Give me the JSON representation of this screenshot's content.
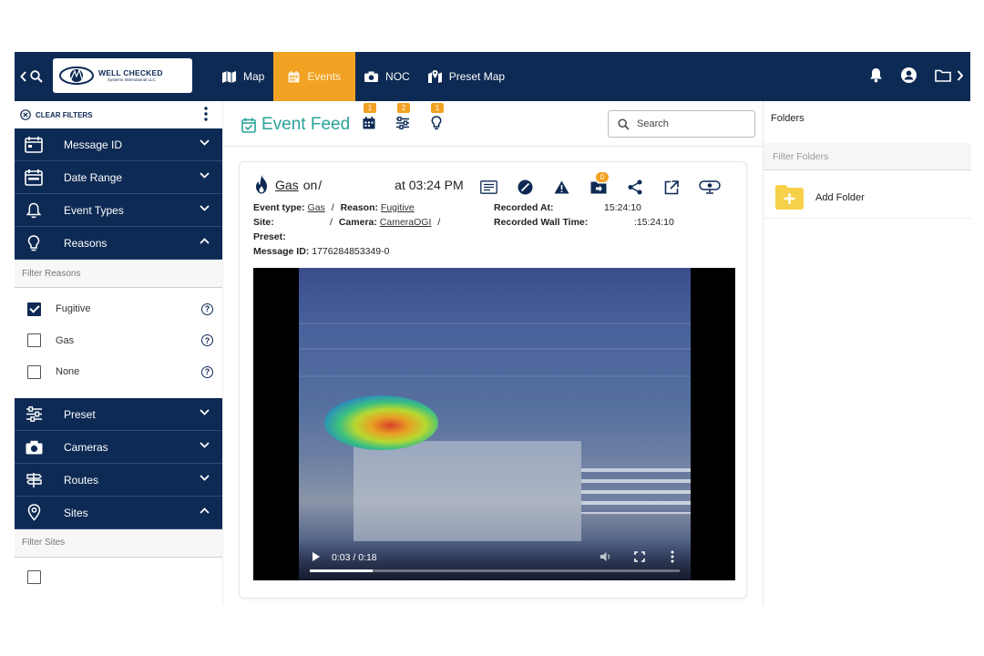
{
  "header": {
    "logo": {
      "title": "WELL CHECKED",
      "subtitle": "Systems International LLC"
    },
    "nav": [
      {
        "label": "Map",
        "icon": "map-icon"
      },
      {
        "label": "Events",
        "icon": "calendar-icon",
        "active": true
      },
      {
        "label": "NOC",
        "icon": "camera-icon"
      },
      {
        "label": "Preset Map",
        "icon": "map-pin-icon"
      }
    ],
    "right_icons": [
      "bell-icon",
      "account-icon",
      "folder-icon",
      "chevron-right-icon"
    ]
  },
  "sidebar": {
    "clear_filters": "CLEAR FILTERS",
    "sections": [
      {
        "label": "Message ID",
        "icon": "card-icon",
        "expanded": false
      },
      {
        "label": "Date Range",
        "icon": "calendar-icon",
        "expanded": false
      },
      {
        "label": "Event Types",
        "icon": "bell-icon",
        "expanded": false
      },
      {
        "label": "Reasons",
        "icon": "lightbulb-icon",
        "expanded": true
      },
      {
        "label": "Preset",
        "icon": "sliders-icon",
        "expanded": false
      },
      {
        "label": "Cameras",
        "icon": "camera-icon",
        "expanded": false
      },
      {
        "label": "Routes",
        "icon": "signpost-icon",
        "expanded": false
      },
      {
        "label": "Sites",
        "icon": "location-icon",
        "expanded": true
      }
    ],
    "reasons": {
      "filter_placeholder": "Filter Reasons",
      "items": [
        {
          "label": "Fugitive",
          "checked": true
        },
        {
          "label": "Gas",
          "checked": false
        },
        {
          "label": "None",
          "checked": false
        }
      ],
      "help_glyph": "?"
    },
    "sites": {
      "filter_placeholder": "Filter Sites"
    }
  },
  "feed": {
    "title": "Event Feed",
    "icons": [
      {
        "name": "calendar-icon",
        "badge": "1"
      },
      {
        "name": "sliders-icon",
        "badge": "2"
      },
      {
        "name": "lightbulb-icon",
        "badge": "1"
      }
    ],
    "search_placeholder": "Search"
  },
  "event": {
    "type_link": "Gas",
    "on_text": "on",
    "slash": "/",
    "time": "at 03:24 PM",
    "folder_badge": "0",
    "labels": {
      "event_type": "Event type:",
      "reason": "Reason:",
      "site": "Site:",
      "camera": "Camera:",
      "preset": "Preset:",
      "message_id": "Message ID:",
      "recorded_at": "Recorded At:",
      "recorded_wall_time": "Recorded Wall Time:"
    },
    "values": {
      "event_type": "Gas",
      "reason": "Fugitive",
      "camera": "CameraOGI",
      "message_id": "1776284853349-0",
      "recorded_at": "15:24:10",
      "recorded_wall_time": ":15:24:10",
      "sep": "/"
    },
    "video": {
      "time": "0:03 / 0:18",
      "progress": 0.17
    }
  },
  "folders": {
    "title": "Folders",
    "filter_placeholder": "Filter Folders",
    "add_label": "Add Folder"
  }
}
